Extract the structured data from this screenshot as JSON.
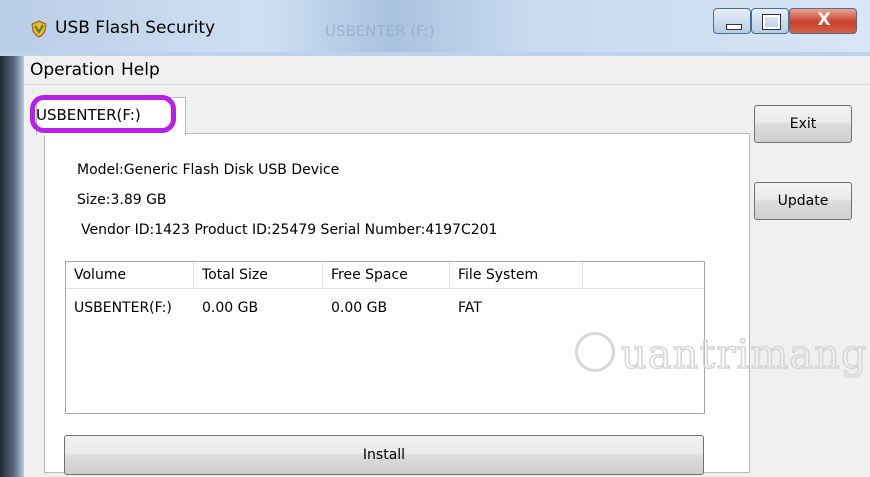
{
  "window": {
    "title": "USB Flash Security",
    "ghost_title": "USBENTER (F:)",
    "close_label": "X"
  },
  "menu": {
    "items": [
      "Operation",
      "Help"
    ]
  },
  "device": {
    "tab_label": "USBENTER(F:)",
    "model": "Model:Generic Flash Disk USB Device",
    "size": "Size:3.89 GB",
    "ids": "Vendor ID:1423  Product ID:25479  Serial Number:4197C201"
  },
  "volumes": {
    "columns": [
      "Volume",
      "Total Size",
      "Free Space",
      "File System"
    ],
    "rows": [
      [
        "USBENTER(F:)",
        "0.00 GB",
        "0.00 GB",
        "FAT"
      ]
    ]
  },
  "buttons": {
    "exit": "Exit",
    "update": "Update",
    "install": "Install"
  },
  "watermark": {
    "text": "uantrimang"
  },
  "colors": {
    "highlight": "#b81fe8",
    "close_button": "#c7402a"
  }
}
